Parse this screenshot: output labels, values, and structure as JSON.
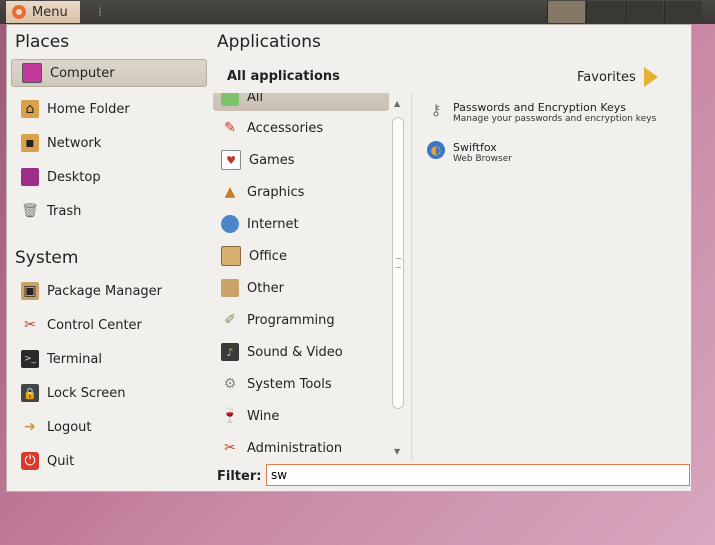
{
  "top_panel": {
    "menu_label": "Menu",
    "grip_glyph": "⁞"
  },
  "places": {
    "title": "Places",
    "items": [
      {
        "label": "Computer",
        "icon": "computer-icon",
        "selected": true
      },
      {
        "label": "Home Folder",
        "icon": "home-folder-icon"
      },
      {
        "label": "Network",
        "icon": "network-icon"
      },
      {
        "label": "Desktop",
        "icon": "desktop-icon"
      },
      {
        "label": "Trash",
        "icon": "trash-icon"
      }
    ]
  },
  "system": {
    "title": "System",
    "items": [
      {
        "label": "Package Manager",
        "icon": "package-manager-icon"
      },
      {
        "label": "Control Center",
        "icon": "control-center-icon"
      },
      {
        "label": "Terminal",
        "icon": "terminal-icon"
      },
      {
        "label": "Lock Screen",
        "icon": "lock-screen-icon"
      },
      {
        "label": "Logout",
        "icon": "logout-icon"
      },
      {
        "label": "Quit",
        "icon": "quit-icon"
      }
    ]
  },
  "applications": {
    "title": "Applications",
    "header": "All applications",
    "favorites_label": "Favorites",
    "categories": [
      {
        "label": "All",
        "icon": "all-icon",
        "selected": true
      },
      {
        "label": "Accessories",
        "icon": "accessories-icon"
      },
      {
        "label": "Games",
        "icon": "games-icon"
      },
      {
        "label": "Graphics",
        "icon": "graphics-icon"
      },
      {
        "label": "Internet",
        "icon": "internet-icon"
      },
      {
        "label": "Office",
        "icon": "office-icon"
      },
      {
        "label": "Other",
        "icon": "other-icon"
      },
      {
        "label": "Programming",
        "icon": "programming-icon"
      },
      {
        "label": "Sound & Video",
        "icon": "sound-video-icon"
      },
      {
        "label": "System Tools",
        "icon": "system-tools-icon"
      },
      {
        "label": "Wine",
        "icon": "wine-icon"
      },
      {
        "label": "Administration",
        "icon": "administration-icon"
      }
    ],
    "results": [
      {
        "name": "Passwords and Encryption Keys",
        "description": "Manage your passwords and encryption keys",
        "icon": "keys-icon"
      },
      {
        "name": "Swiftfox",
        "description": "Web Browser",
        "icon": "swiftfox-icon"
      }
    ]
  },
  "filter": {
    "label": "Filter:",
    "value": "sw"
  },
  "colors": {
    "accent_orange": "#e86d2e",
    "filter_border": "#e07a4f",
    "menu_bg": "#f2f0ec"
  }
}
